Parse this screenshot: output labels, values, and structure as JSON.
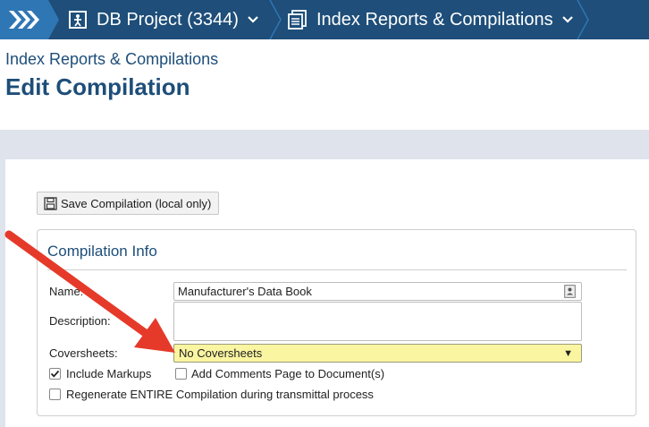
{
  "nav": {
    "project_label": "DB Project (3344)",
    "section_label": "Index Reports & Compilations"
  },
  "page": {
    "subtitle": "Index Reports & Compilations",
    "title": "Edit Compilation"
  },
  "toolbar": {
    "save_label": "Save Compilation (local only)"
  },
  "compilation_info": {
    "title": "Compilation Info",
    "name_label": "Name:",
    "name_value": "Manufacturer's Data Book",
    "description_label": "Description:",
    "description_value": "",
    "coversheets_label": "Coversheets:",
    "coversheets_value": "No Coversheets",
    "include_markups_label": "Include Markups",
    "include_markups_checked": true,
    "add_comments_label": "Add Comments Page to Document(s)",
    "add_comments_checked": false,
    "regenerate_label": "Regenerate ENTIRE Compilation during transmittal process",
    "regenerate_checked": false
  },
  "colors": {
    "nav_bg": "#1e4e79",
    "nav_home": "#2f76b4",
    "title_color": "#1e4e79",
    "highlight_field": "#faf5a0",
    "annotation_arrow": "#e53a2a"
  },
  "icons": [
    "chevrons-right-icon",
    "project-icon",
    "chevron-down-icon",
    "compilation-icon",
    "save-icon",
    "contact-card-icon",
    "dropdown-caret-icon",
    "checkmark-icon",
    "annotation-arrow"
  ]
}
